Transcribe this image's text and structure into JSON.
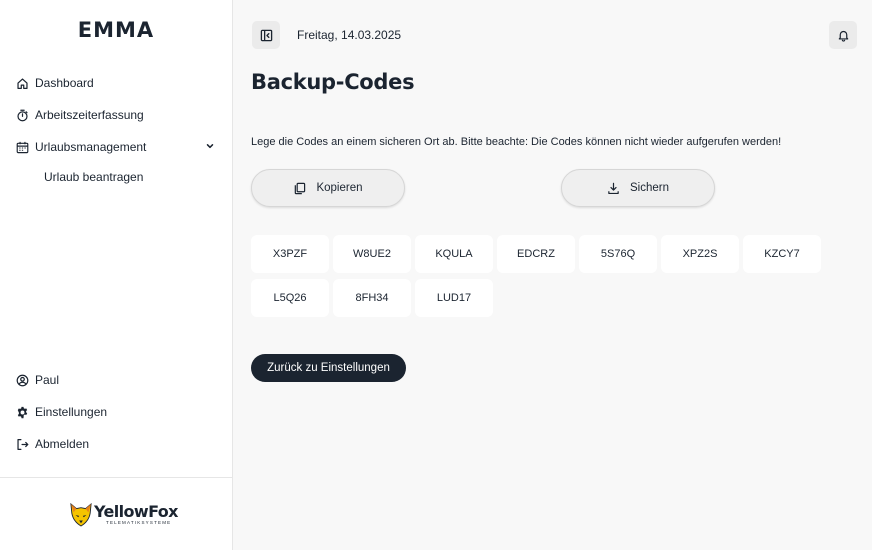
{
  "app": {
    "title": "EMMA"
  },
  "sidebar": {
    "items": [
      {
        "label": "Dashboard",
        "icon": "home-icon"
      },
      {
        "label": "Arbeitszeiterfassung",
        "icon": "stopwatch-icon"
      },
      {
        "label": "Urlaubsmanagement",
        "icon": "calendar-icon",
        "expanded": true,
        "children": [
          {
            "label": "Urlaub beantragen"
          }
        ]
      }
    ],
    "bottom_items": [
      {
        "label": "Paul",
        "icon": "user-circle-icon"
      },
      {
        "label": "Einstellungen",
        "icon": "gear-icon"
      },
      {
        "label": "Abmelden",
        "icon": "logout-icon"
      }
    ],
    "logo": {
      "name": "YellowFox",
      "tagline": "TELEMATIKSYSTEME",
      "icon": "fox-logo-icon"
    }
  },
  "header": {
    "date": "Freitag, 14.03.2025",
    "toggle_icon": "sidebar-toggle-icon",
    "bell_icon": "bell-icon"
  },
  "page": {
    "title": "Backup-Codes",
    "description": "Lege die Codes an einem sicheren Ort ab. Bitte beachte: Die Codes können nicht wieder aufgerufen werden!",
    "copy_label": "Kopieren",
    "save_label": "Sichern",
    "codes": [
      "X3PZF",
      "W8UE2",
      "KQULA",
      "EDCRZ",
      "5S76Q",
      "XPZ2S",
      "KZCY7",
      "L5Q26",
      "8FH34",
      "LUD17"
    ],
    "back_label": "Zurück zu Einstellungen"
  },
  "colors": {
    "primary": "#1b2430",
    "background": "#f8f8f8",
    "sidebar": "#ffffff",
    "logo_yellow": "#f5c400",
    "logo_orange": "#e8821c"
  }
}
